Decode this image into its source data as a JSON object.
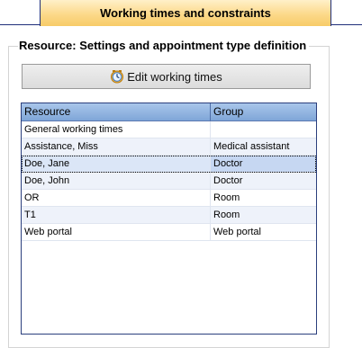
{
  "header": {
    "tab_label": "Working times and constraints"
  },
  "group": {
    "title": "Resource: Settings and appointment type definition"
  },
  "toolbar": {
    "edit_button_label": "Edit working times",
    "edit_button_icon": "clock-icon"
  },
  "table": {
    "columns": [
      "Resource",
      "Group"
    ],
    "selected_index": 2,
    "rows": [
      {
        "resource": "General working times",
        "group": ""
      },
      {
        "resource": "Assistance, Miss",
        "group": "Medical assistant"
      },
      {
        "resource": "Doe, Jane",
        "group": "Doctor"
      },
      {
        "resource": "Doe, John",
        "group": "Doctor"
      },
      {
        "resource": "OR",
        "group": "Room"
      },
      {
        "resource": "T1",
        "group": "Room"
      },
      {
        "resource": "Web portal",
        "group": "Web portal"
      }
    ]
  },
  "colors": {
    "tab_gradient": "#fcd98a",
    "header_blue": "#7fa6d8",
    "border_navy": "#1f2f7a",
    "selection": "#dbe6f7"
  }
}
